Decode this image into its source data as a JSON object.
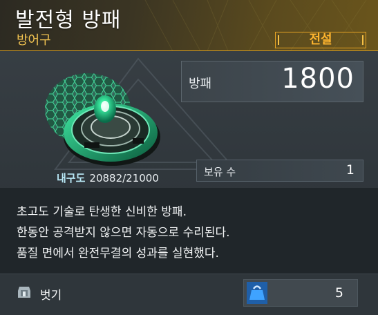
{
  "item": {
    "name": "발전형 방패",
    "category": "방어구",
    "grade": "전설",
    "icon": "hex-shield-art"
  },
  "stat": {
    "label": "방패",
    "value": "1800"
  },
  "durability": {
    "label": "내구도",
    "value": "20882/21000"
  },
  "owned": {
    "label": "보유 수",
    "value": "1"
  },
  "description": [
    "초고도 기술로 탄생한 신비한 방패.",
    "한동안 공격받지 않으면 자동으로 수리된다.",
    "품질 면에서 완전무결의 성과를 실현했다."
  ],
  "footer": {
    "unequip_label": "벗기",
    "unequip_icon": "unequip-armor-icon",
    "price_icon": "weight-bag-icon",
    "price_value": "5"
  },
  "colors": {
    "grade_accent": "#e8a423",
    "subtitle": "#f2c451",
    "shield_green": "#22d48a",
    "price_icon_bg": "#1f5fa8"
  }
}
